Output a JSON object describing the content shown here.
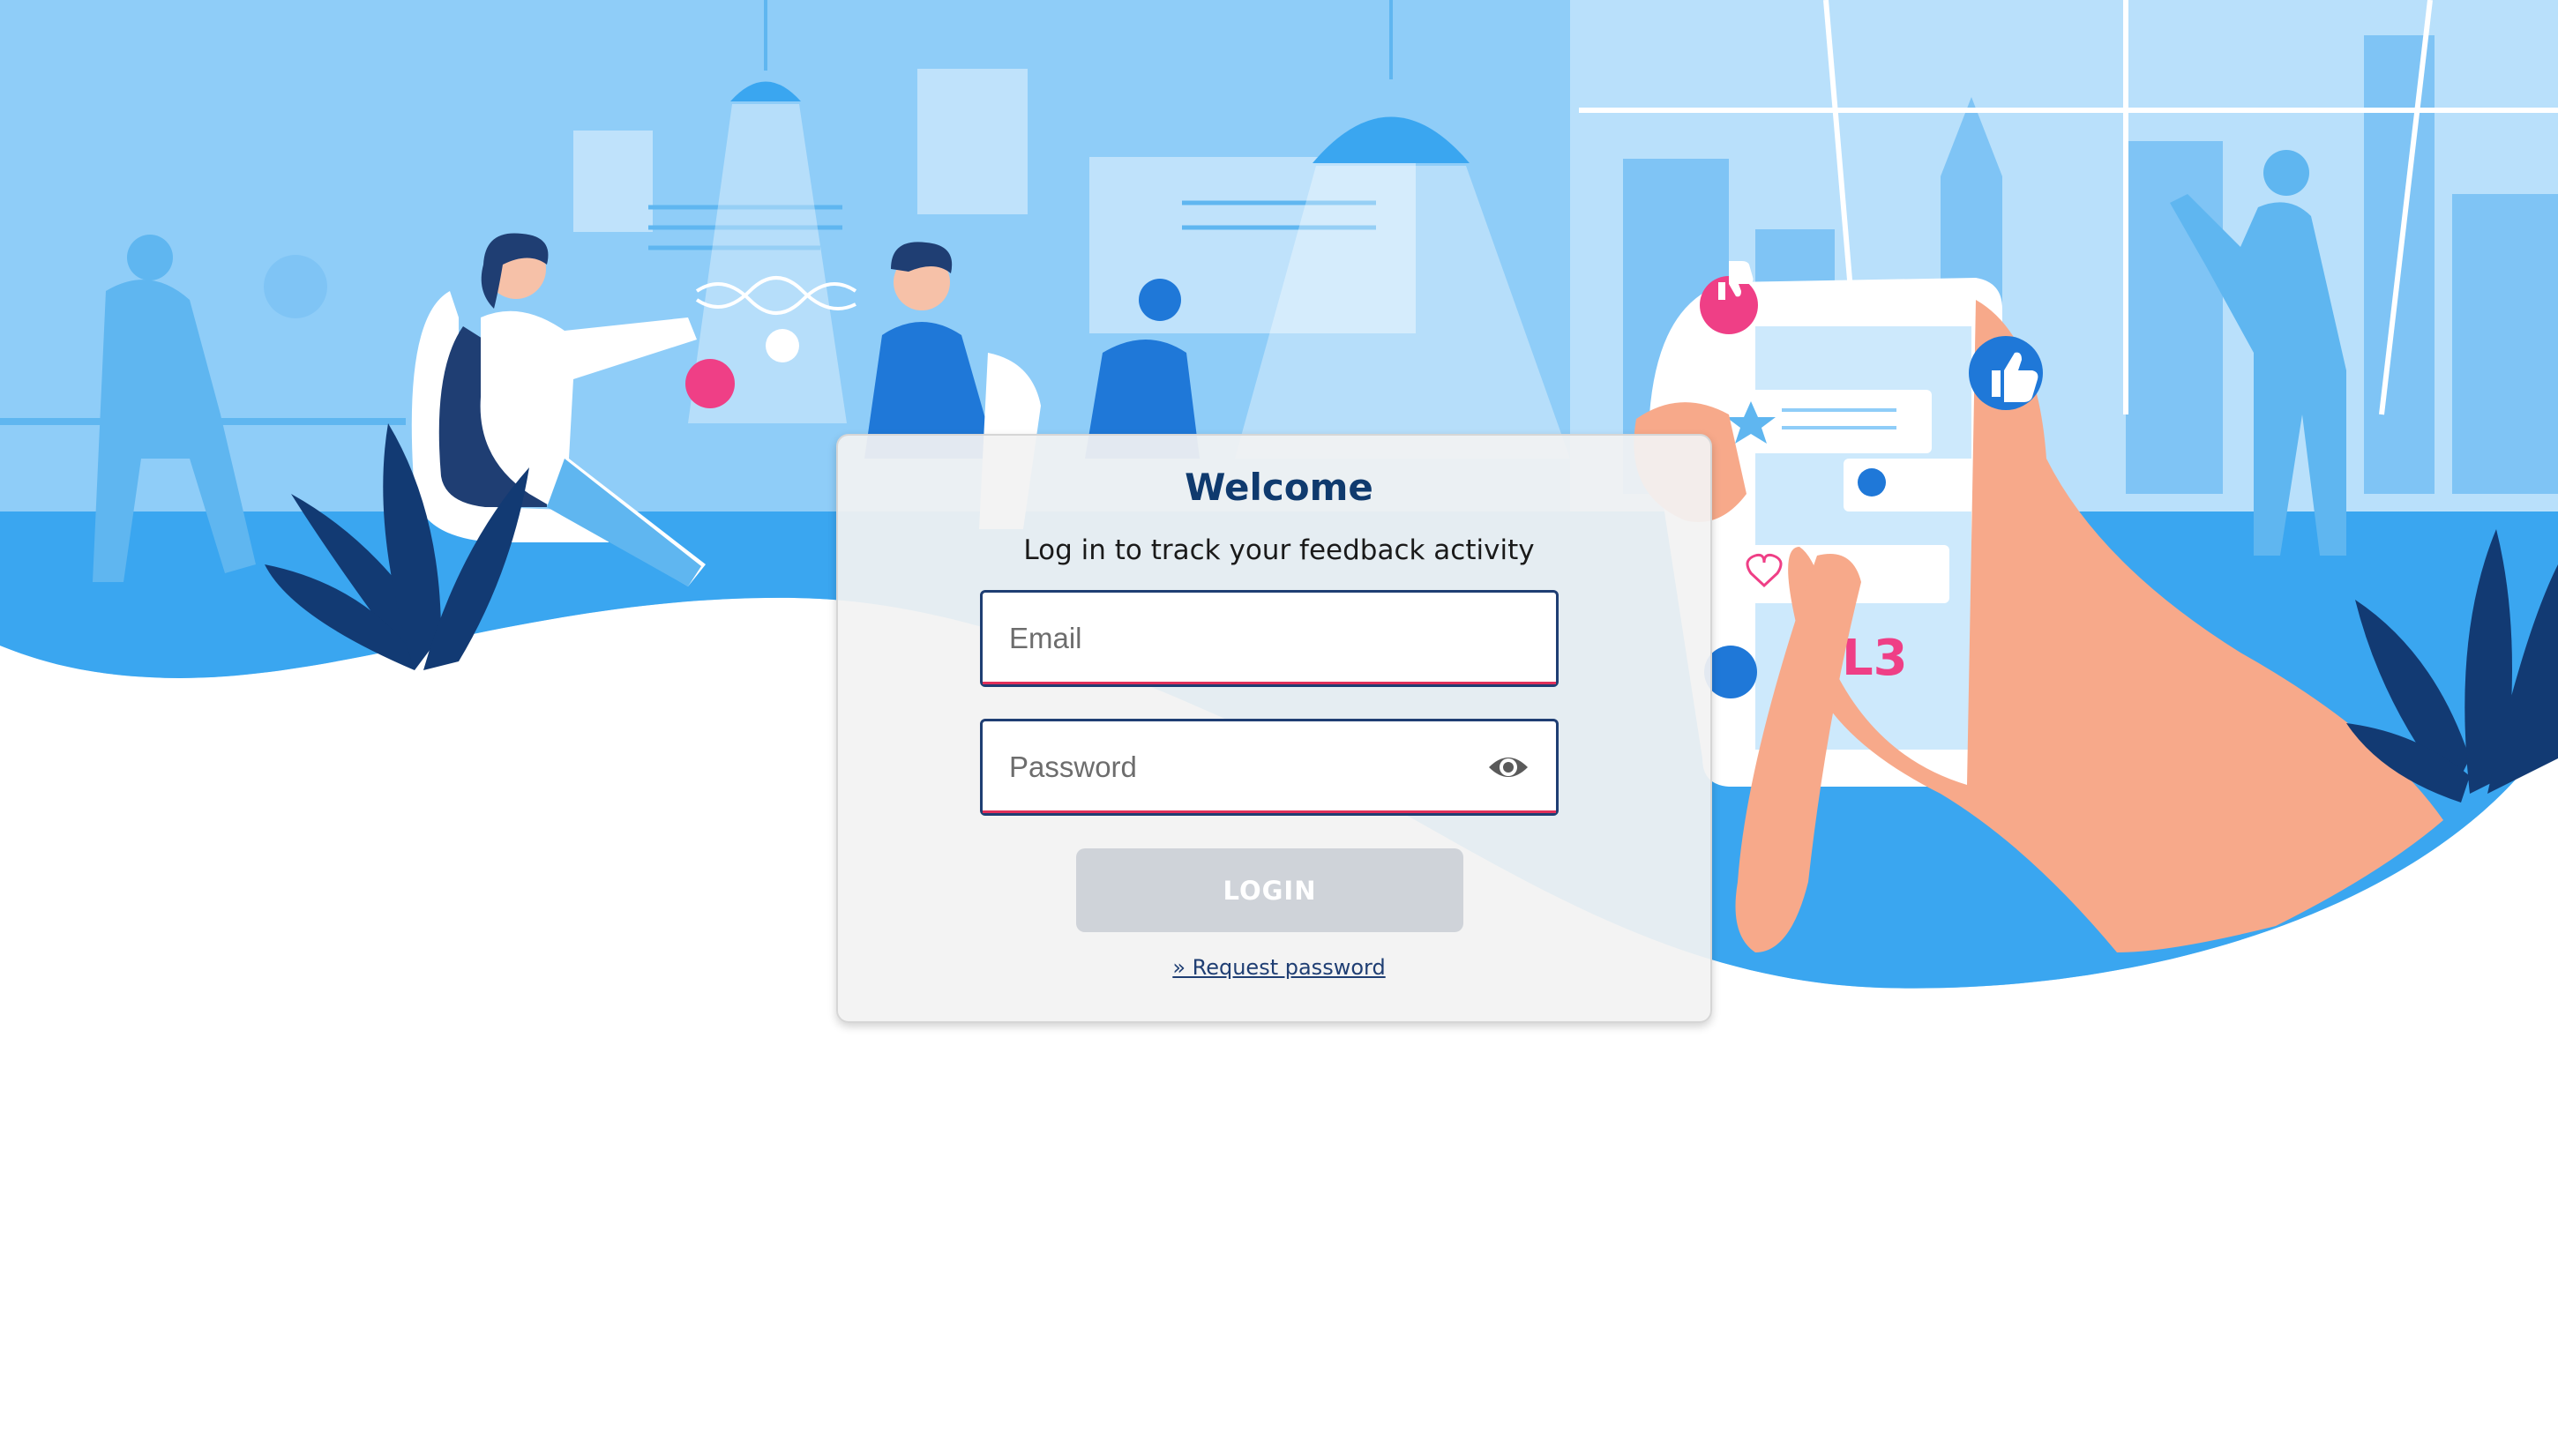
{
  "login": {
    "title": "Welcome",
    "subtitle": "Log in to track your feedback activity",
    "email_placeholder": "Email",
    "password_placeholder": "Password",
    "login_label": "LOGIN",
    "request_password_label": "» Request password"
  },
  "icons": {
    "show_password": "eye-icon"
  },
  "colors": {
    "primary": "#1f3e73",
    "title": "#0f3a6e",
    "accent": "#e1305a",
    "button_disabled": "#cfd3d9",
    "hero_sky": "#8fcdf8"
  }
}
